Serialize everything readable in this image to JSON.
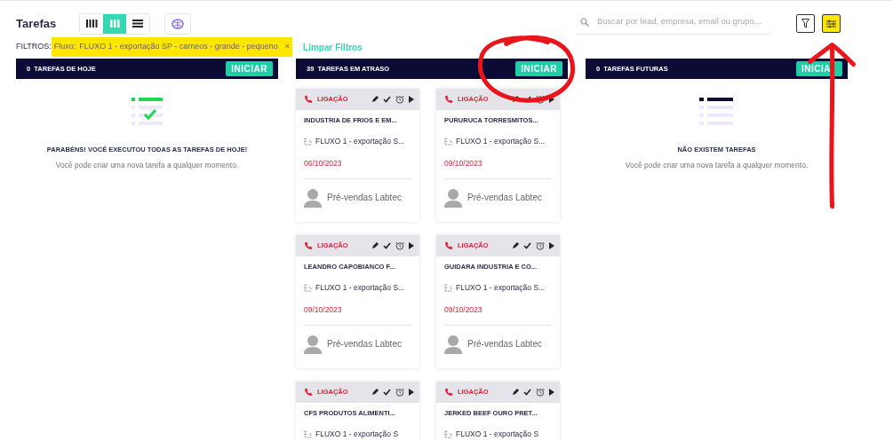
{
  "page_title": "Tarefas",
  "view_modes": [
    {
      "kind": "kanban",
      "selected": false
    },
    {
      "kind": "columns",
      "selected": true
    },
    {
      "kind": "list",
      "selected": false
    }
  ],
  "search": {
    "placeholder": "Buscar por lead, empresa, email ou grupo..."
  },
  "settings_button": {
    "highlighted": true,
    "arrow_annotation": true
  },
  "filters": {
    "label": "FILTROS:",
    "chips": [
      {
        "key": "Fluxo:",
        "value": "FLUXO 1 - exportação SP - carneos - grande - pequeno",
        "remove": "×",
        "highlighted": true
      }
    ],
    "clear": "Limpar Filtros"
  },
  "columns": [
    {
      "count": "0",
      "title": "TAREFAS DE HOJE",
      "button": "INICIAR",
      "empty": {
        "kind": "done",
        "title": "PARABÉNS! VOCÊ EXECUTOU TODAS AS TAREFAS DE HOJE!",
        "text": "Você pode criar uma nova tarefa a qualquer momento."
      }
    },
    {
      "count": "39",
      "title": "TAREFAS EM ATRASO",
      "button": "INICIAR",
      "circled": true,
      "cards": [
        {
          "type": "LIGAÇÃO",
          "company": "INDUSTRIA DE FRIOS E EM...",
          "flow": "FLUXO 1 - exportação S...",
          "date": "06/10/2023",
          "owner": "Pré-vendas Labtec"
        },
        {
          "type": "LIGAÇÃO",
          "company": "PURURUCA TORRESMITOS...",
          "flow": "FLUXO 1 - exportação S...",
          "date": "09/10/2023",
          "owner": "Pré-vendas Labtec"
        },
        {
          "type": "LIGAÇÃO",
          "company": "LEANDRO CAPOBIANCO F...",
          "flow": "FLUXO 1 - exportação S...",
          "date": "09/10/2023",
          "owner": "Pré-vendas Labtec"
        },
        {
          "type": "LIGAÇÃO",
          "company": "GUIDARA INDUSTRIA E CO...",
          "flow": "FLUXO 1 - exportação S...",
          "date": "09/10/2023",
          "owner": "Pré-vendas Labtec"
        },
        {
          "type": "LIGAÇÃO",
          "company": "CFS PRODUTOS ALIMENTI...",
          "flow": "FLUXO 1 - exportação S"
        },
        {
          "type": "LIGAÇÃO",
          "company": "JERKED BEEF OURO PRET...",
          "flow": "FLUXO 1 - exportação S"
        }
      ]
    },
    {
      "count": "0",
      "title": "TAREFAS FUTURAS",
      "button": "INICIA",
      "empty": {
        "kind": "none",
        "title": "NÃO EXISTEM TAREFAS",
        "text": "Você pode criar uma nova tarefa a qualquer momento."
      }
    }
  ]
}
